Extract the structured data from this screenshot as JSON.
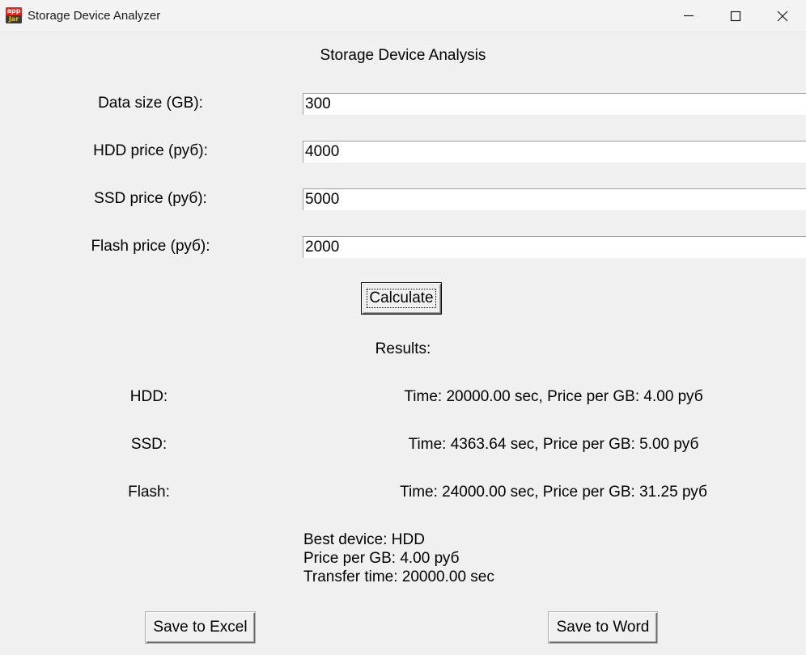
{
  "window": {
    "title": "Storage Device Analyzer",
    "icon_top_text": "app",
    "icon_bottom_text": "Jar"
  },
  "heading": "Storage Device Analysis",
  "fields": [
    {
      "label": "Data size (GB):",
      "value": "300"
    },
    {
      "label": "HDD price (руб):",
      "value": "4000"
    },
    {
      "label": "SSD price (руб):",
      "value": "5000"
    },
    {
      "label": "Flash price (руб):",
      "value": "2000"
    }
  ],
  "calculate_label": "Calculate",
  "results": {
    "title": "Results:",
    "rows": [
      {
        "label": "HDD:",
        "value": "Time: 20000.00 sec, Price per GB: 4.00 руб"
      },
      {
        "label": "SSD:",
        "value": "Time: 4363.64 sec, Price per GB: 5.00 руб"
      },
      {
        "label": "Flash:",
        "value": "Time: 24000.00 sec, Price per GB: 31.25 руб"
      }
    ],
    "summary": {
      "best_device": "Best device: HDD",
      "price_per_gb": "Price per GB: 4.00 руб",
      "transfer_time": "Transfer time: 20000.00 sec"
    }
  },
  "buttons": {
    "save_excel": "Save to Excel",
    "save_word": "Save to Word"
  },
  "icons": {
    "minimize": "minimize-icon",
    "maximize": "maximize-icon",
    "close": "close-icon",
    "app": "app-icon"
  }
}
